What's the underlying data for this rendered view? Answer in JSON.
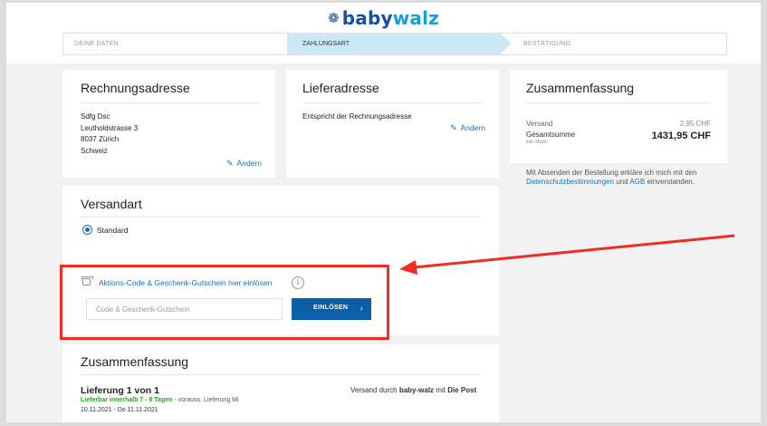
{
  "header": {
    "logo_part1": "baby",
    "logo_part2": "walz",
    "steps": [
      "DEINE DATEN",
      "ZAHLUNGSART",
      "BESTÄTIGUNG"
    ]
  },
  "billing": {
    "title": "Rechnungsadresse",
    "lines": [
      "Sdfg Dsc",
      "Leutholdstrasse 3",
      "8037 Zürich",
      "Schweiz"
    ],
    "edit_label": "Ändern"
  },
  "delivery": {
    "title": "Lieferadresse",
    "text": "Entspricht der Rechnungsadresse",
    "edit_label": "Ändern"
  },
  "summary_side": {
    "title": "Zusammenfassung",
    "shipping_label": "Versand",
    "shipping_value": "2,95 CHF",
    "total_label": "Gesamtsumme",
    "vat_note": "inkl. MwSt.",
    "total_value": "1431,95 CHF"
  },
  "notice": {
    "text_before": "Mit Absenden der Bestellung erkläre ich mich mit den",
    "privacy_link": "Datenschutzbestimmungen",
    "and": "und",
    "agb_link": "AGB",
    "text_after": "einverstanden."
  },
  "shipping_method": {
    "title": "Versandart",
    "option": "Standard"
  },
  "promo": {
    "link": "Aktions-Code & Geschenk-Gutschein hier einlösen",
    "info": "i",
    "placeholder": "Code & Geschenk-Gutschein",
    "button": "EINLÖSEN",
    "button_chevron": "›"
  },
  "order_summary": {
    "title": "Zusammenfassung",
    "delivery_title": "Lieferung 1 von 1",
    "availability": "Lieferbar innerhalb 7 - 8 Tagen",
    "expected": " - vorauss. Lieferung Mi",
    "dates": "10.11.2021 - Do 11.11.2021",
    "shipped_by_prefix": "Versand durch",
    "shipped_by_company": "baby-walz",
    "shipped_with": "mit",
    "carrier": "Die Post"
  },
  "colors": {
    "brand_dark": "#1a4fa0",
    "brand_light": "#1a9cd8",
    "link": "#1a6fb5",
    "button": "#0b5ea8",
    "highlight": "#ee2d24",
    "availability": "#2a9d2a"
  }
}
